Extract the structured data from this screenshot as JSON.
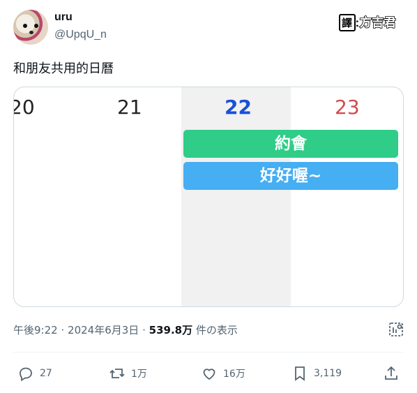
{
  "user": {
    "name": "uru",
    "handle": "@UpqU_n"
  },
  "translator": {
    "prefix": "譯",
    "name": "方吉君"
  },
  "post": {
    "text": "和朋友共用的日曆"
  },
  "calendar": {
    "dates": [
      "20",
      "21",
      "22",
      "23"
    ],
    "events": [
      "約會",
      "好好喔~"
    ],
    "colors": {
      "today": "#1a4fd8",
      "weekend": "#d24a4a",
      "event_green": "#2fcd88",
      "event_blue": "#46aef2"
    }
  },
  "meta": {
    "time": "午後9:22",
    "separator": "·",
    "date": "2024年6月3日",
    "views_count": "539.8万",
    "views_label": "件の表示"
  },
  "actions": {
    "replies": "27",
    "reposts": "1万",
    "likes": "16万",
    "bookmarks": "3,119"
  },
  "icons": [
    "reply-icon",
    "repost-icon",
    "like-icon",
    "bookmark-icon",
    "share-icon",
    "analytics-icon"
  ]
}
